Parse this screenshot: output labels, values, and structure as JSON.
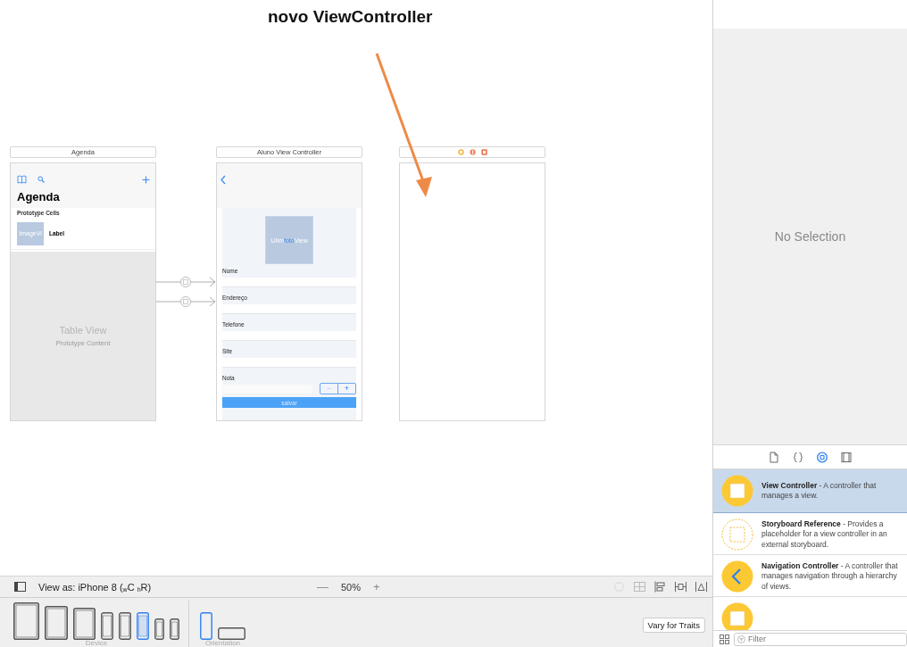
{
  "annotation": {
    "text": "novo ViewController"
  },
  "scenes": [
    {
      "kind": "table",
      "title": "Agenda",
      "nav_title": "Agenda",
      "section": "Prototype Cells",
      "cell_image": "ImageVi",
      "cell_label": "Label",
      "table_title": "Table View",
      "table_subtitle": "Prototype Content"
    },
    {
      "kind": "form",
      "title": "Aluno View Controller",
      "image_label": [
        "UIIm",
        "foto",
        "View"
      ],
      "fields": [
        "Nome",
        "Endereço",
        "Telefone",
        "Site",
        "Nota"
      ],
      "stepper": {
        "minus": "−",
        "plus": "+"
      },
      "save": "salvar"
    },
    {
      "kind": "empty"
    }
  ],
  "toolbar": {
    "view_as": "View as: iPhone 8 ($_{w}$C $_{h}$R)",
    "zoom_out": "—",
    "zoom": "50%",
    "zoom_in": "+"
  },
  "devices": [
    {
      "kind": "largetablet",
      "selected": false
    },
    {
      "kind": "tablet",
      "selected": false
    },
    {
      "kind": "smalltablet",
      "selected": false
    },
    {
      "kind": "phone",
      "selected": false
    },
    {
      "kind": "phone",
      "selected": false
    },
    {
      "kind": "phone",
      "selected": true
    },
    {
      "kind": "smallphone",
      "selected": false
    },
    {
      "kind": "smallphone",
      "selected": false
    }
  ],
  "device_label": "Device",
  "orientations": [
    {
      "kind": "portrait",
      "selected": true
    },
    {
      "kind": "landscape",
      "selected": false
    }
  ],
  "orientation_label": "Orientation",
  "vary_button": "Vary for Traits",
  "inspector": {
    "empty_text": "No Selection"
  },
  "library_tabs": [
    {
      "kind": "file",
      "selected": false
    },
    {
      "kind": "braces",
      "selected": false
    },
    {
      "kind": "object",
      "selected": true
    },
    {
      "kind": "media",
      "selected": false
    }
  ],
  "library_items": [
    {
      "kind": "controller",
      "selected": true,
      "name": "View Controller",
      "description": "- A controller that manages a view."
    },
    {
      "kind": "reference",
      "selected": false,
      "name": "Storyboard Reference",
      "description": "- Provides a placeholder for a view controller in an external storyboard."
    },
    {
      "kind": "navigation",
      "selected": false,
      "name": "Navigation Controller",
      "description": "- A controller that manages navigation through a hierarchy of views."
    },
    {
      "kind": "controller",
      "selected": false
    }
  ],
  "filter": {
    "placeholder": "Filter"
  }
}
